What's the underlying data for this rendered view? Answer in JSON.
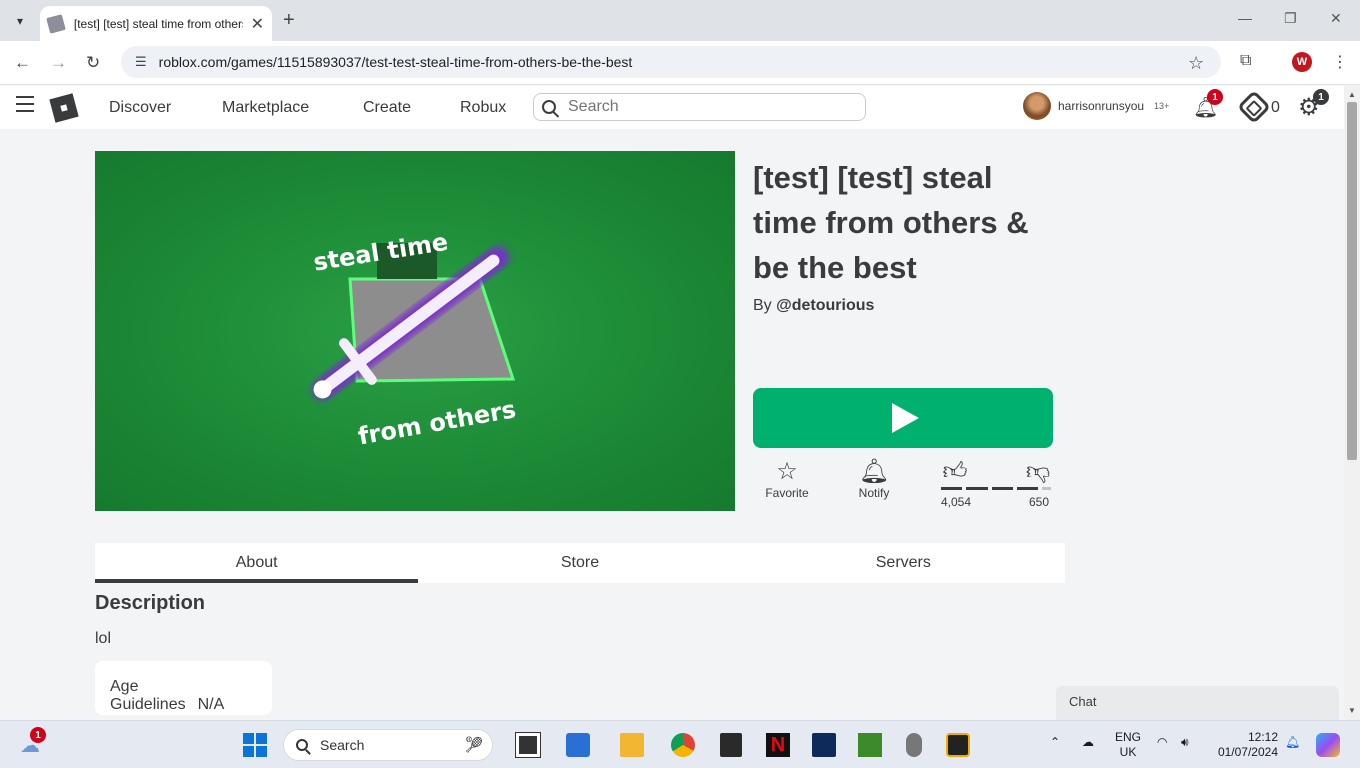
{
  "browser": {
    "tab_title": "[test] [test] steal time from others & be the best",
    "url": "roblox.com/games/11515893037/test-test-steal-time-from-others-be-the-best",
    "profile_initial": "W"
  },
  "header": {
    "nav": [
      "Discover",
      "Marketplace",
      "Create",
      "Robux"
    ],
    "search_placeholder": "Search",
    "username": "harrisonrunsyou",
    "age_badge": "13+",
    "notification_count": "1",
    "robux_balance": "0",
    "settings_badge": "1"
  },
  "game": {
    "title": "[test] [test] steal time from others & be the best",
    "by_label": "By",
    "creator": "@detourious",
    "thumbnail_text_top": "steal time",
    "thumbnail_text_bottom": "from others",
    "favorite_label": "Favorite",
    "notify_label": "Notify",
    "upvotes": "4,054",
    "downvotes": "650",
    "upvote_ratio": 0.86
  },
  "tabs": [
    "About",
    "Store",
    "Servers"
  ],
  "active_tab": "About",
  "about": {
    "description_heading": "Description",
    "description": "lol",
    "age_guidelines_label": "Age Guidelines",
    "age_guidelines_value": "N/A"
  },
  "chat": {
    "label": "Chat"
  },
  "taskbar": {
    "weather_badge": "1",
    "search_label": "Search",
    "lang_top": "ENG",
    "lang_bottom": "UK",
    "time": "12:12",
    "date": "01/07/2024"
  }
}
